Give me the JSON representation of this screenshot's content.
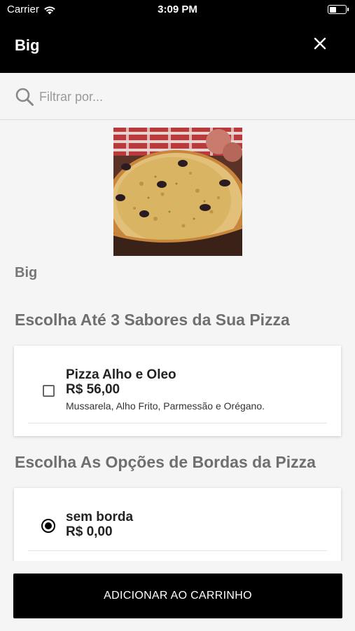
{
  "status_bar": {
    "carrier": "Carrier",
    "time": "3:09 PM",
    "wifi_icon": "wifi-icon",
    "battery_icon": "battery-icon"
  },
  "nav": {
    "title": "Big",
    "close_icon": "close-icon"
  },
  "search": {
    "placeholder": "Filtrar por...",
    "icon": "search-icon"
  },
  "product": {
    "image": "pizza-photo",
    "name": "Big"
  },
  "sections": [
    {
      "title": "Escolha Até 3 Sabores da Sua Pizza",
      "options": [
        {
          "name": "Pizza Alho e Oleo",
          "price": "R$ 56,00",
          "description": "Mussarela, Alho Frito, Parmessão e Orégano.",
          "checked": false
        }
      ]
    },
    {
      "title": "Escolha As Opções de Bordas da Pizza",
      "options": [
        {
          "name": "sem borda",
          "price": "R$ 0,00",
          "selected": true
        }
      ]
    }
  ],
  "footer": {
    "add_button_label": "ADICIONAR AO CARRINHO"
  },
  "colors": {
    "header_bg": "#000000",
    "page_bg": "#f5f5f5",
    "button_bg": "#000000",
    "section_title": "#6f6f6f"
  }
}
